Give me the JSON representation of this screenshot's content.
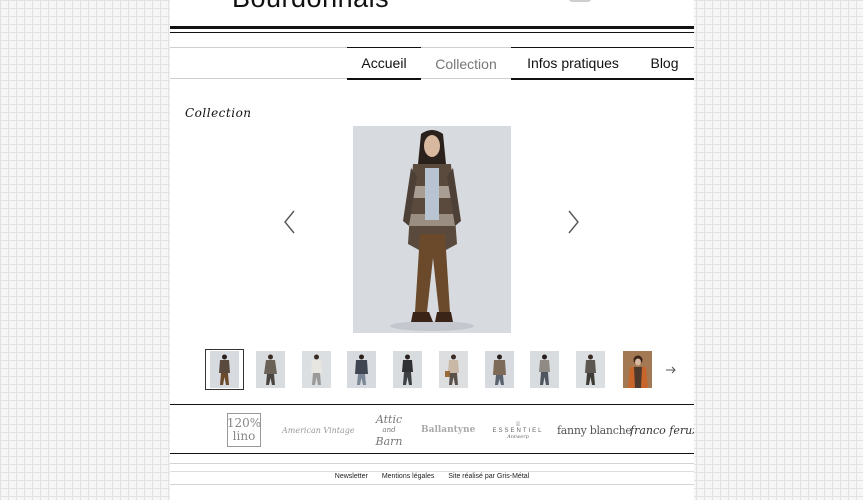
{
  "header": {
    "brand": "Bourdonnais"
  },
  "nav": {
    "items": [
      {
        "label": "Accueil",
        "state": "active"
      },
      {
        "label": "Collection",
        "state": "current"
      },
      {
        "label": "Infos pratiques",
        "state": "active"
      },
      {
        "label": "Blog",
        "state": "active"
      }
    ]
  },
  "main": {
    "section_title": "Collection",
    "gallery": {
      "thumbnail_count": 10,
      "selected_index": 0
    }
  },
  "brands": {
    "logos": [
      {
        "text_top": "120%",
        "text_bottom": "lino"
      },
      {
        "text": "American Vintage"
      },
      {
        "text_top": "Attic",
        "text_mid": "and",
        "text_bottom": "Barn"
      },
      {
        "text": "Ballantyne"
      },
      {
        "text_top": "ESSENTIEL",
        "text_bottom": "Antwerp"
      },
      {
        "text": "fanny blanche"
      },
      {
        "text": "franco feruzzi"
      }
    ]
  },
  "footer": {
    "links": [
      "Newsletter",
      "Mentions légales",
      "Site réalisé par Gris-Métal"
    ]
  },
  "colors": {
    "photo_background": "#d7dbe0",
    "cardigan": "#5a4a3e",
    "trousers": "#6b4a2c",
    "text": "#111111",
    "nav_current": "#777777"
  }
}
